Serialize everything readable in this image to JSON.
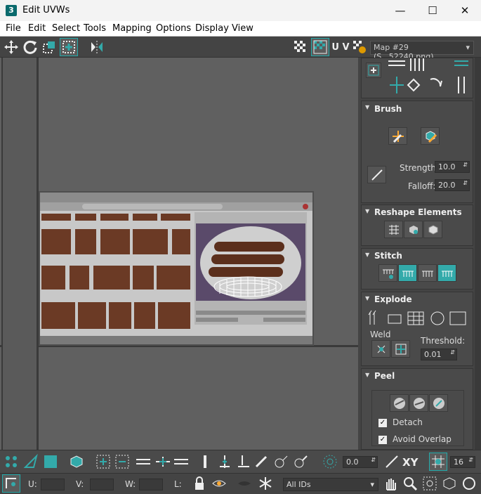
{
  "window": {
    "title": "Edit UVWs",
    "app_icon": "3"
  },
  "menu": [
    "File",
    "Edit",
    "Select",
    "Tools",
    "Mapping",
    "Options",
    "Display",
    "View"
  ],
  "toolbar": {
    "uv_label": "U V",
    "map_select": "Map #29 (S...52240.png)"
  },
  "brush": {
    "title": "Brush",
    "strength_label": "Strength:",
    "strength_value": "10.0",
    "falloff_label": "Falloff:",
    "falloff_value": "20.0"
  },
  "reshape": {
    "title": "Reshape Elements"
  },
  "stitch": {
    "title": "Stitch"
  },
  "explode": {
    "title": "Explode",
    "weld_label": "Weld",
    "threshold_label": "Threshold:",
    "threshold_value": "0.01"
  },
  "peel": {
    "title": "Peel",
    "detach_label": "Detach",
    "avoid_overlap_label": "Avoid Overlap"
  },
  "bottom": {
    "angle_value": "0.0",
    "xy_label": "XY",
    "grid_value": "16",
    "u_label": "U:",
    "v_label": "V:",
    "w_label": "W:",
    "l_label": "L:",
    "ids_select": "All IDs"
  },
  "colors": {
    "teal": "#33aaaa",
    "bg": "#444444",
    "viewport": "#606060"
  }
}
